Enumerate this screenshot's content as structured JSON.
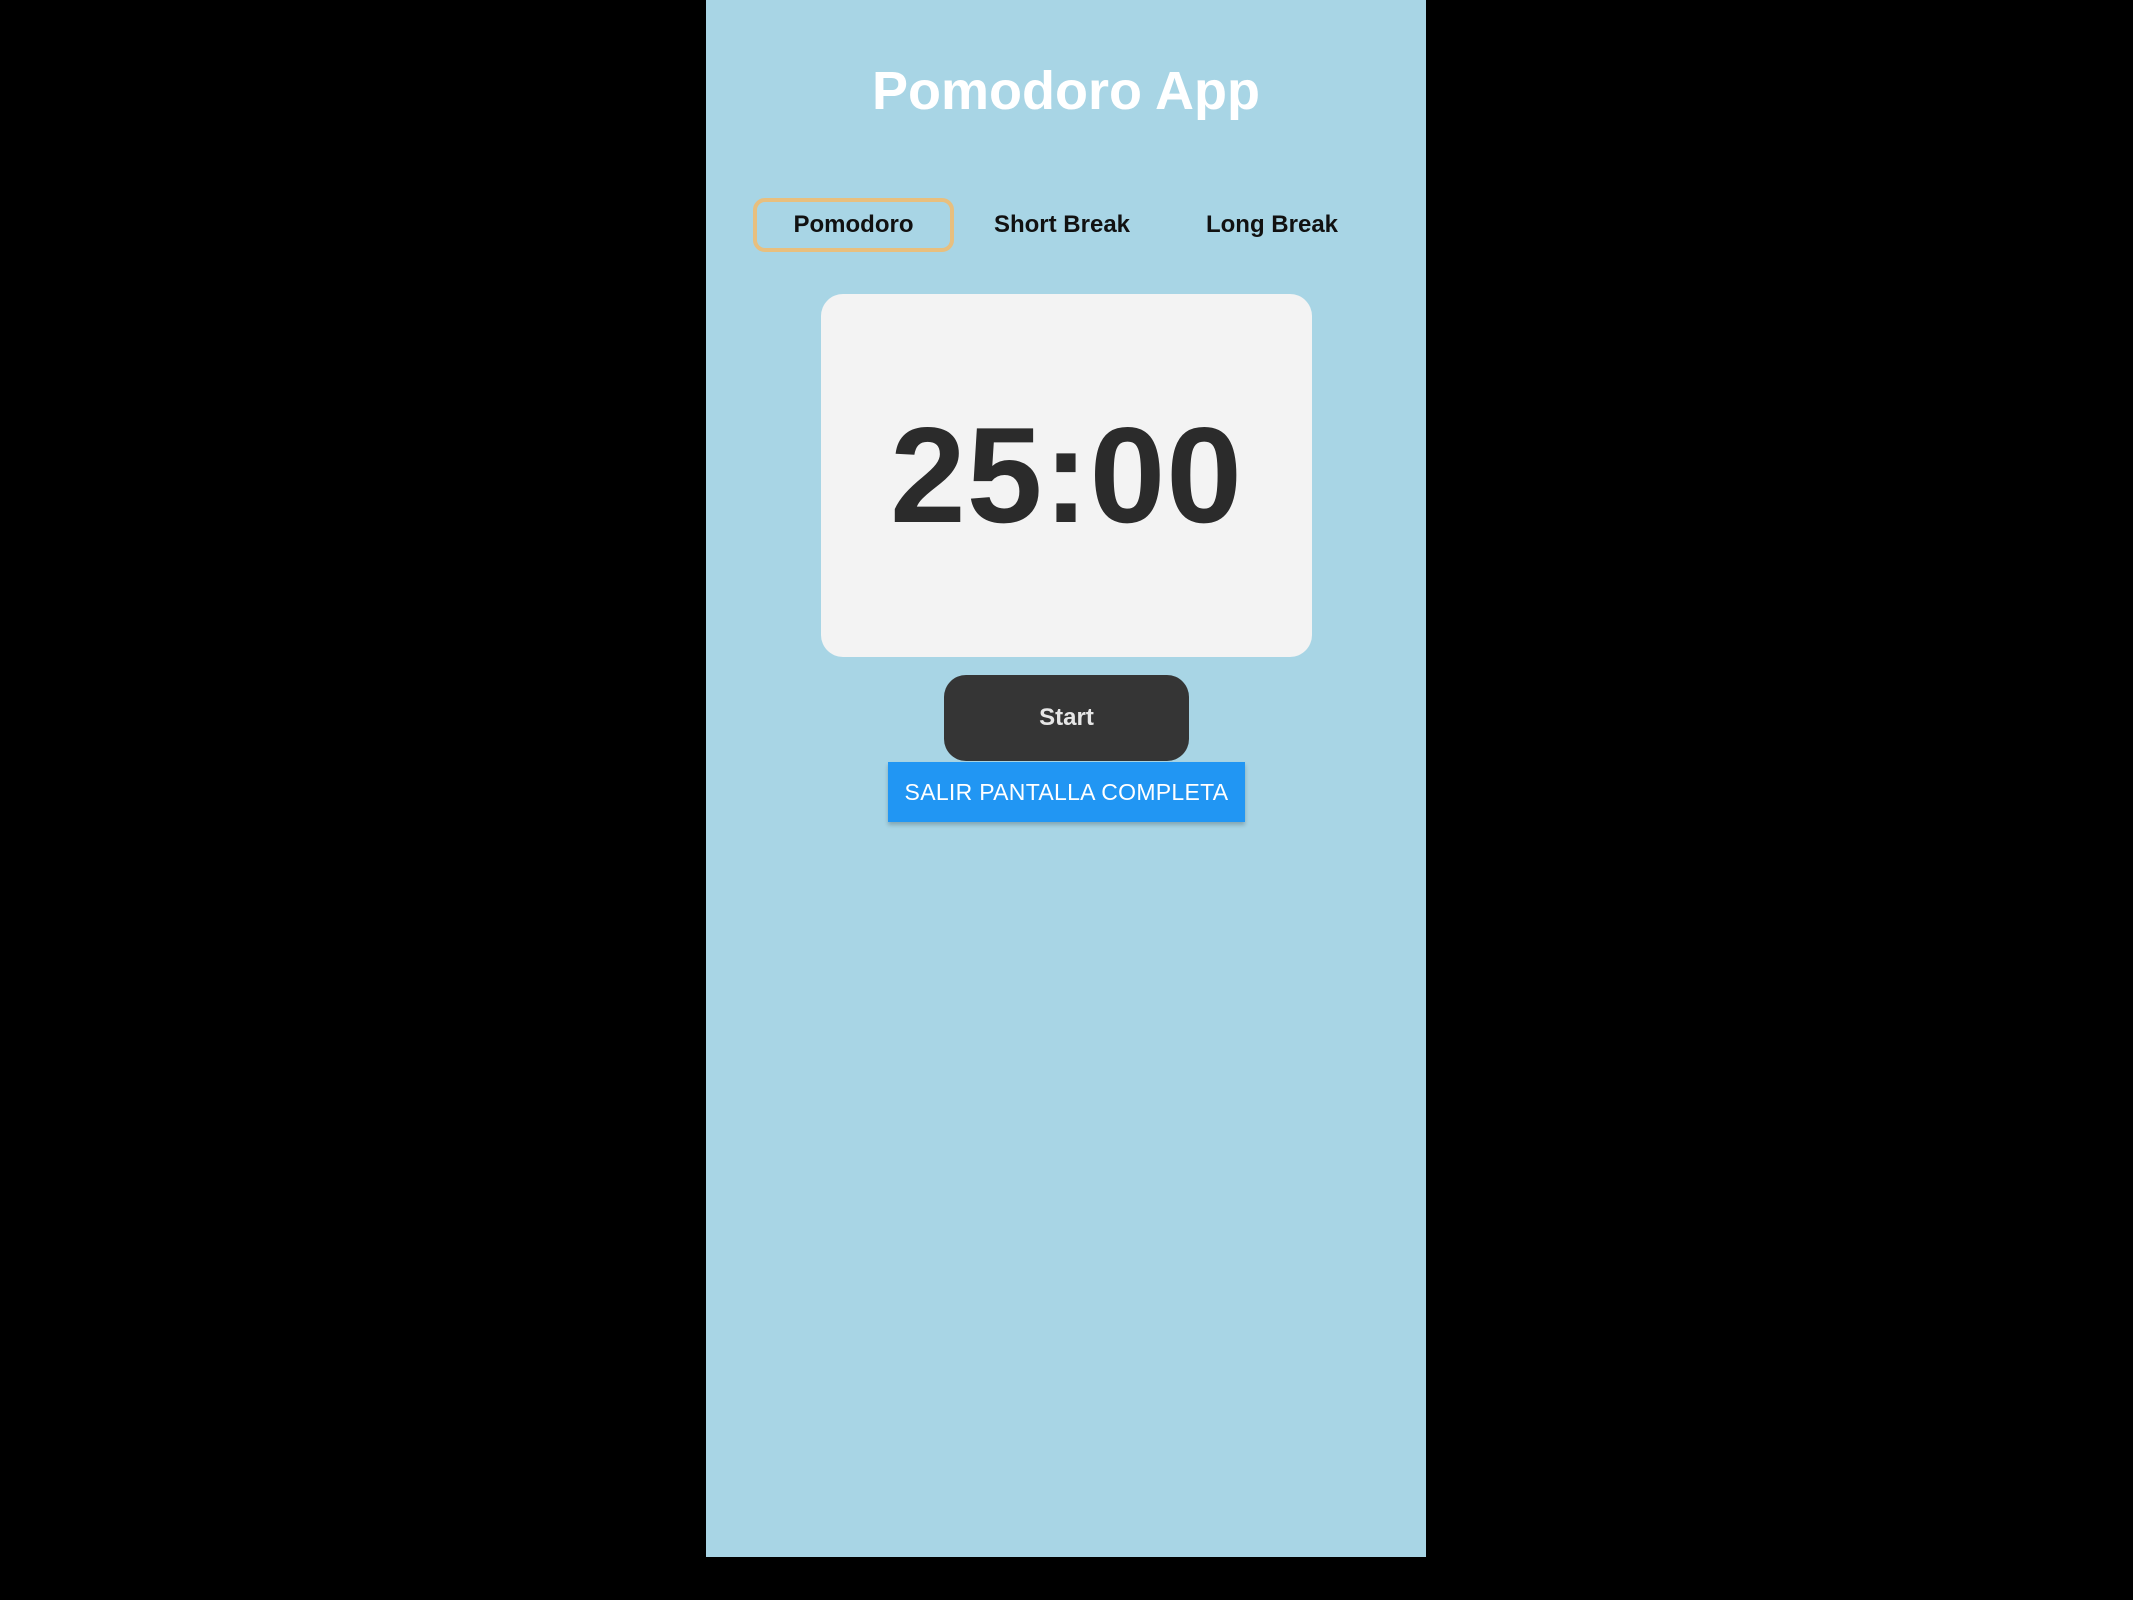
{
  "app": {
    "title": "Pomodoro App"
  },
  "tabs": [
    {
      "label": "Pomodoro",
      "active": true
    },
    {
      "label": "Short Break",
      "active": false
    },
    {
      "label": "Long Break",
      "active": false
    }
  ],
  "timer": {
    "display": "25:00"
  },
  "controls": {
    "start_label": "Start",
    "fullscreen_label": "SALIR PANTALLA COMPLETA"
  },
  "colors": {
    "background": "#a8d5e5",
    "active_tab_border": "#e8bf7e",
    "timer_card": "#f3f3f3",
    "start_button": "#353535",
    "fullscreen_button": "#2196f3"
  }
}
